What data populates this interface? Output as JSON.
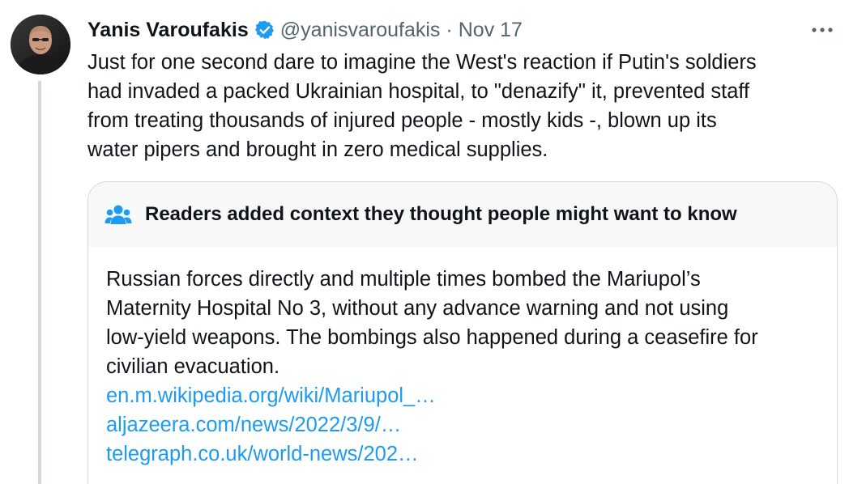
{
  "tweet": {
    "author_name": "Yanis Varoufakis",
    "handle": "@yanisvaroufakis",
    "separator": "·",
    "date": "Nov 17",
    "verified_color": "#1d9bf0",
    "text_lines": [
      "Just for one second dare to imagine the West's reaction if Putin's soldiers",
      "had invaded a packed Ukrainian hospital, to \"denazify\" it, prevented staff",
      "from treating thousands of injured people - mostly kids -, blown up its",
      "water pipers and brought in zero medical supplies."
    ]
  },
  "community_note": {
    "title": "Readers added context they thought people might want to know",
    "icon": "people-icon",
    "body_lines": [
      "Russian forces directly and multiple times bombed the Mariupol’s",
      "Maternity Hospital No 3, without any advance warning and not using",
      "low-yield weapons. The bombings also happened during a ceasefire for",
      "civilian evacuation."
    ],
    "links": [
      "en.m.wikipedia.org/wiki/Mariupol_…",
      "aljazeera.com/news/2022/3/9/…",
      "telegraph.co.uk/world-news/202…"
    ],
    "link_color": "#1d9bf0"
  }
}
